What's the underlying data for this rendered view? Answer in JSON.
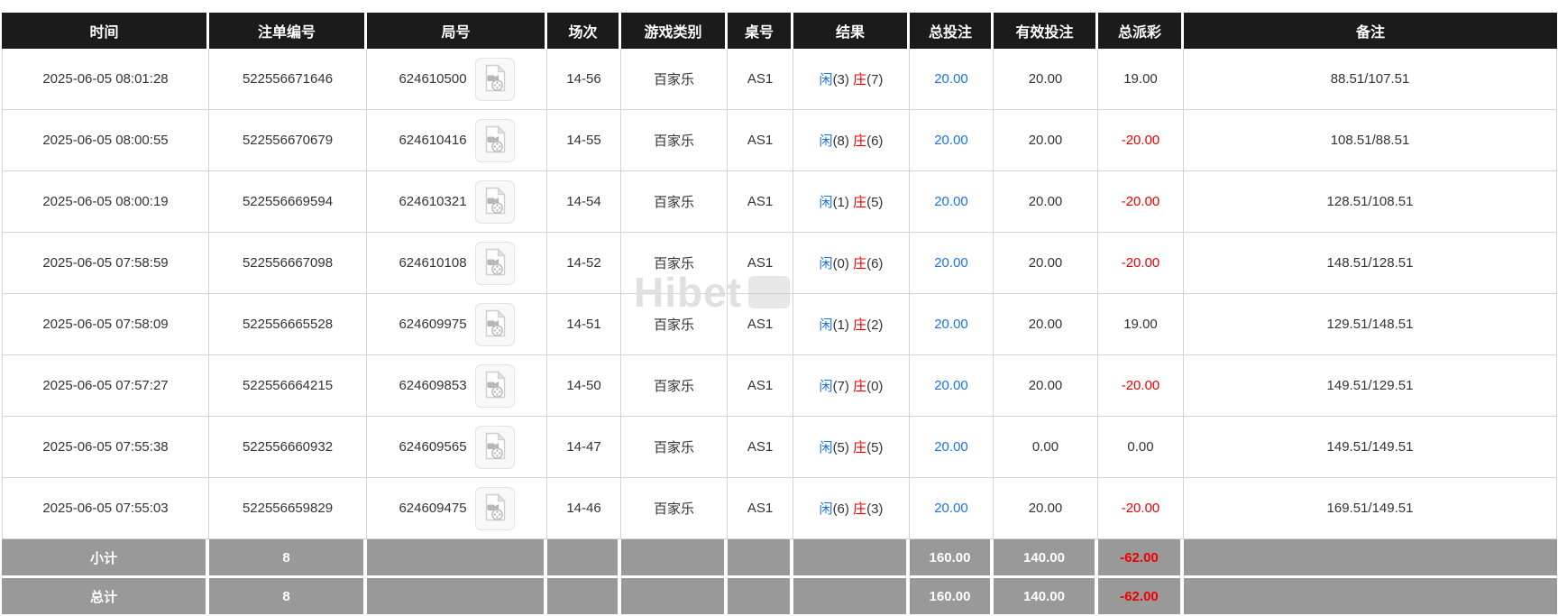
{
  "colors": {
    "header_bg": "#1b1b1b",
    "summary_bg": "#999999",
    "player_blue": "#1a73e8",
    "bet_amount_blue": "#1a73e8",
    "banker_red": "#ee0000",
    "negative_red": "#ee0000"
  },
  "watermark": {
    "text": "Hibet"
  },
  "table": {
    "columns": [
      "时间",
      "注单编号",
      "局号",
      "场次",
      "游戏类别",
      "桌号",
      "结果",
      "总投注",
      "有效投注",
      "总派彩",
      "备注"
    ],
    "rows": [
      {
        "time": "2025-06-05 08:01:28",
        "bet_no": "522556671646",
        "round_no": "624610500",
        "session": "14-56",
        "game": "百家乐",
        "table_no": "AS1",
        "result_p": "闲",
        "result_pv": "(3)",
        "result_b": "庄",
        "result_bv": "(7)",
        "total_bet": "20.00",
        "valid_bet": "20.00",
        "payout": "19.00",
        "remark": "88.51/107.51"
      },
      {
        "time": "2025-06-05 08:00:55",
        "bet_no": "522556670679",
        "round_no": "624610416",
        "session": "14-55",
        "game": "百家乐",
        "table_no": "AS1",
        "result_p": "闲",
        "result_pv": "(8)",
        "result_b": "庄",
        "result_bv": "(6)",
        "total_bet": "20.00",
        "valid_bet": "20.00",
        "payout": "-20.00",
        "remark": "108.51/88.51"
      },
      {
        "time": "2025-06-05 08:00:19",
        "bet_no": "522556669594",
        "round_no": "624610321",
        "session": "14-54",
        "game": "百家乐",
        "table_no": "AS1",
        "result_p": "闲",
        "result_pv": "(1)",
        "result_b": "庄",
        "result_bv": "(5)",
        "total_bet": "20.00",
        "valid_bet": "20.00",
        "payout": "-20.00",
        "remark": "128.51/108.51"
      },
      {
        "time": "2025-06-05 07:58:59",
        "bet_no": "522556667098",
        "round_no": "624610108",
        "session": "14-52",
        "game": "百家乐",
        "table_no": "AS1",
        "result_p": "闲",
        "result_pv": "(0)",
        "result_b": "庄",
        "result_bv": "(6)",
        "total_bet": "20.00",
        "valid_bet": "20.00",
        "payout": "-20.00",
        "remark": "148.51/128.51"
      },
      {
        "time": "2025-06-05 07:58:09",
        "bet_no": "522556665528",
        "round_no": "624609975",
        "session": "14-51",
        "game": "百家乐",
        "table_no": "AS1",
        "result_p": "闲",
        "result_pv": "(1)",
        "result_b": "庄",
        "result_bv": "(2)",
        "total_bet": "20.00",
        "valid_bet": "20.00",
        "payout": "19.00",
        "remark": "129.51/148.51"
      },
      {
        "time": "2025-06-05 07:57:27",
        "bet_no": "522556664215",
        "round_no": "624609853",
        "session": "14-50",
        "game": "百家乐",
        "table_no": "AS1",
        "result_p": "闲",
        "result_pv": "(7)",
        "result_b": "庄",
        "result_bv": "(0)",
        "total_bet": "20.00",
        "valid_bet": "20.00",
        "payout": "-20.00",
        "remark": "149.51/129.51"
      },
      {
        "time": "2025-06-05 07:55:38",
        "bet_no": "522556660932",
        "round_no": "624609565",
        "session": "14-47",
        "game": "百家乐",
        "table_no": "AS1",
        "result_p": "闲",
        "result_pv": "(5)",
        "result_b": "庄",
        "result_bv": "(5)",
        "total_bet": "20.00",
        "valid_bet": "0.00",
        "payout": "0.00",
        "remark": "149.51/149.51"
      },
      {
        "time": "2025-06-05 07:55:03",
        "bet_no": "522556659829",
        "round_no": "624609475",
        "session": "14-46",
        "game": "百家乐",
        "table_no": "AS1",
        "result_p": "闲",
        "result_pv": "(6)",
        "result_b": "庄",
        "result_bv": "(3)",
        "total_bet": "20.00",
        "valid_bet": "20.00",
        "payout": "-20.00",
        "remark": "169.51/149.51"
      }
    ],
    "subtotal": {
      "label": "小计",
      "count": "8",
      "total_bet": "160.00",
      "valid_bet": "140.00",
      "payout": "-62.00",
      "remark": ""
    },
    "total": {
      "label": "总计",
      "count": "8",
      "total_bet": "160.00",
      "valid_bet": "140.00",
      "payout": "-62.00",
      "remark": ""
    }
  }
}
